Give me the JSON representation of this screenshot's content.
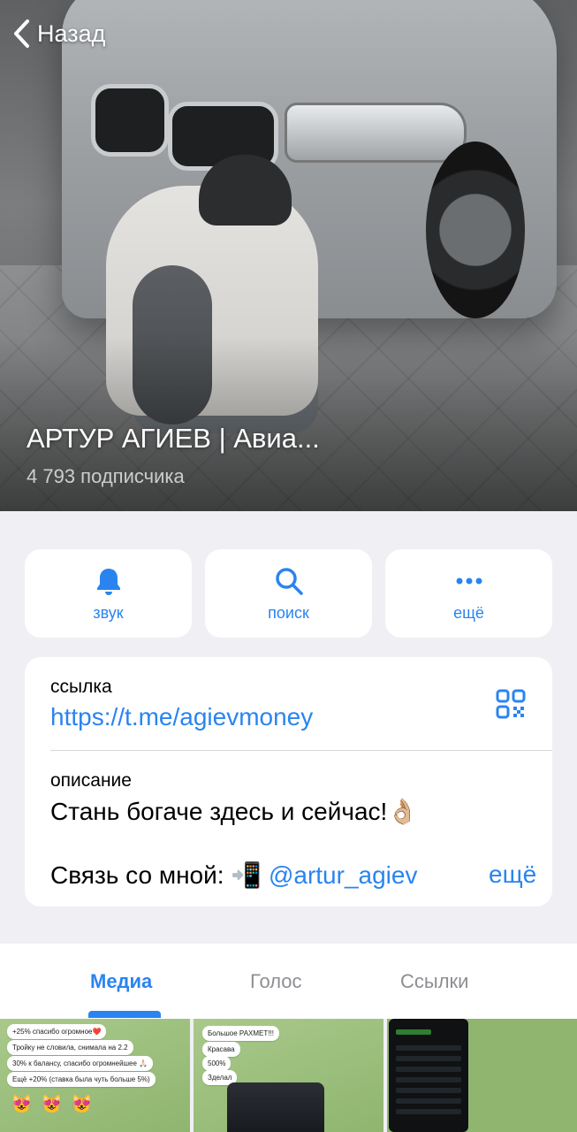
{
  "header": {
    "back_label": "Назад",
    "channel_title": "АРТУР АГИЕВ | Авиа...",
    "subscribers": "4 793 подписчика"
  },
  "actions": [
    {
      "label": "звук",
      "icon": "bell-icon"
    },
    {
      "label": "поиск",
      "icon": "search-icon"
    },
    {
      "label": "ещё",
      "icon": "more-icon"
    }
  ],
  "info": {
    "link_label": "ссылка",
    "link_value": "https://t.me/agievmoney",
    "description_label": "описание",
    "description_text": "Стань богаче здесь и сейчас!👌🏼",
    "contact_prefix": "Связь со мной: 📲",
    "contact_handle": "@artur_agiev",
    "more_label": "ещё"
  },
  "tabs": [
    {
      "label": "Медиа",
      "active": true
    },
    {
      "label": "Голос",
      "active": false
    },
    {
      "label": "Ссылки",
      "active": false
    }
  ],
  "media": {
    "thumb1": {
      "messages": [
        "+25% спасибо огромное❤️",
        "Тройку не словила, снимала на 2.2",
        "30% к балансу, спасибо огромнейшее 🙏🏻",
        "Ещё +20% (ставка была чуть больше 5%)"
      ],
      "emoji": [
        "😻",
        "😻",
        "😻"
      ]
    },
    "thumb2": {
      "messages": [
        "Большое РАХМЕТ!!!",
        "Красава",
        "500%",
        "Зделал"
      ]
    }
  },
  "colors": {
    "accent": "#2a84f0",
    "background": "#efeff4",
    "card": "#ffffff"
  }
}
